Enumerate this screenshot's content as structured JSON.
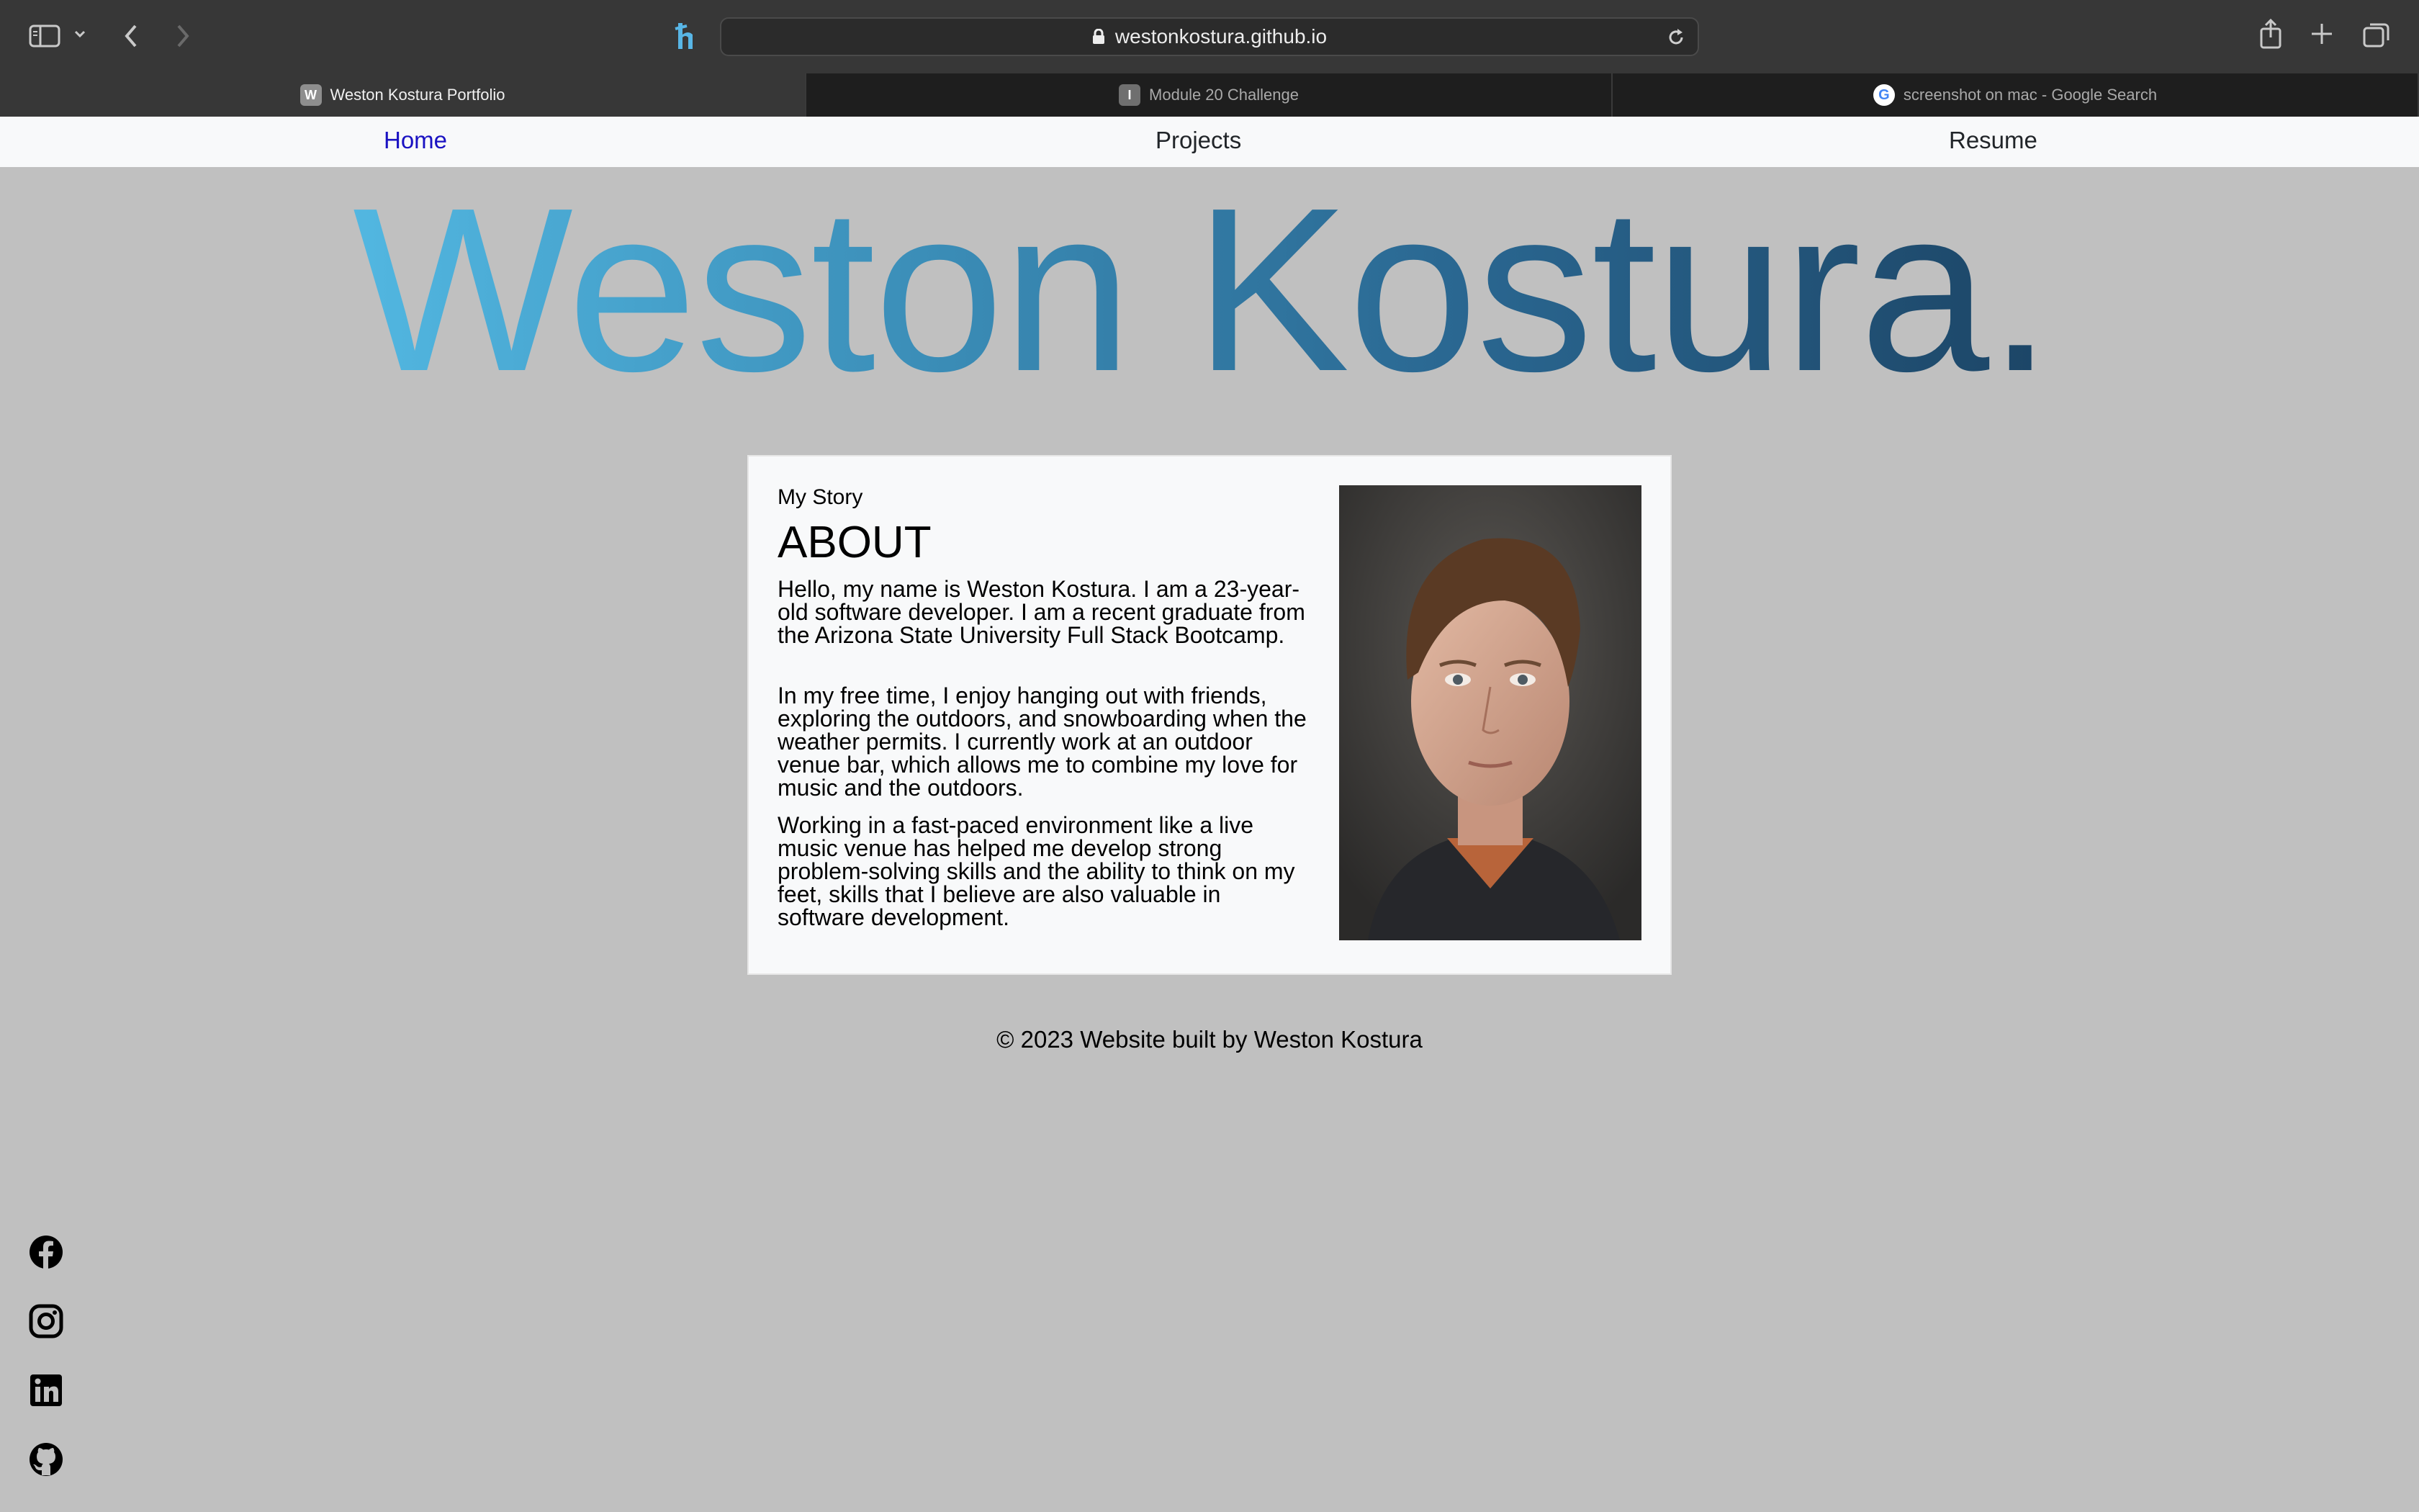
{
  "browser": {
    "url": "westonkostura.github.io",
    "tabs": [
      {
        "label": "Weston Kostura Portfolio",
        "favicon": "W"
      },
      {
        "label": "Module 20 Challenge",
        "favicon": "I"
      },
      {
        "label": "screenshot on mac - Google Search",
        "favicon": "G"
      }
    ]
  },
  "nav": {
    "home": "Home",
    "projects": "Projects",
    "resume": "Resume"
  },
  "hero": {
    "title": "Weston Kostura."
  },
  "about": {
    "eyebrow": "My Story",
    "heading": "ABOUT",
    "paragraphs": [
      "Hello, my name is Weston Kostura. I am a 23-year-old software developer. I am a recent graduate from the Arizona State University Full Stack Bootcamp.",
      "In my free time, I enjoy hanging out with friends, exploring the outdoors, and snowboarding when the weather permits. I currently work at an outdoor venue bar, which allows me to combine my love for music and the outdoors.",
      "Working in a fast-paced environment like a live music venue has helped me develop strong problem-solving skills and the ability to think on my feet, skills that I believe are also valuable in software development."
    ]
  },
  "footer": {
    "text": "© 2023 Website built by Weston Kostura"
  },
  "social": [
    "facebook-icon",
    "instagram-icon",
    "linkedin-icon",
    "github-icon"
  ]
}
